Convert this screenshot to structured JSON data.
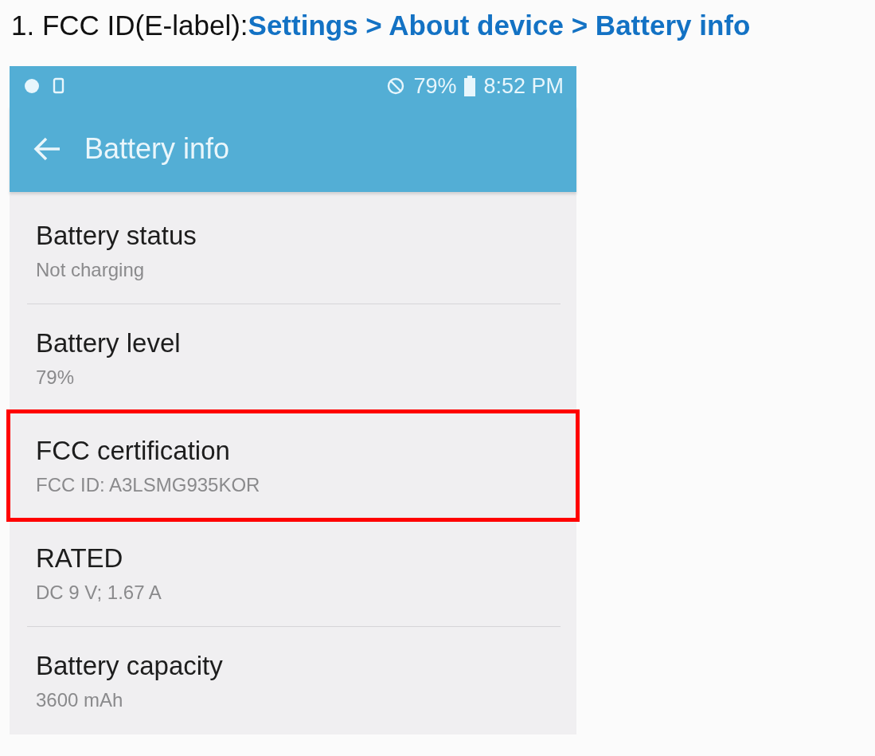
{
  "caption": {
    "prefix": "1. FCC ID(E-label): ",
    "path": "Settings > About device > Battery info"
  },
  "status_bar": {
    "battery_percent": "79%",
    "time": "8:52 PM"
  },
  "toolbar": {
    "title": "Battery info"
  },
  "items": [
    {
      "title": "Battery status",
      "value": "Not charging",
      "highlighted": false
    },
    {
      "title": "Battery level",
      "value": "79%",
      "highlighted": false
    },
    {
      "title": "FCC certification",
      "value": "FCC ID: A3LSMG935KOR",
      "highlighted": true
    },
    {
      "title": "RATED",
      "value": "DC 9 V; 1.67 A",
      "highlighted": false
    },
    {
      "title": "Battery capacity",
      "value": "3600 mAh",
      "highlighted": false
    }
  ]
}
